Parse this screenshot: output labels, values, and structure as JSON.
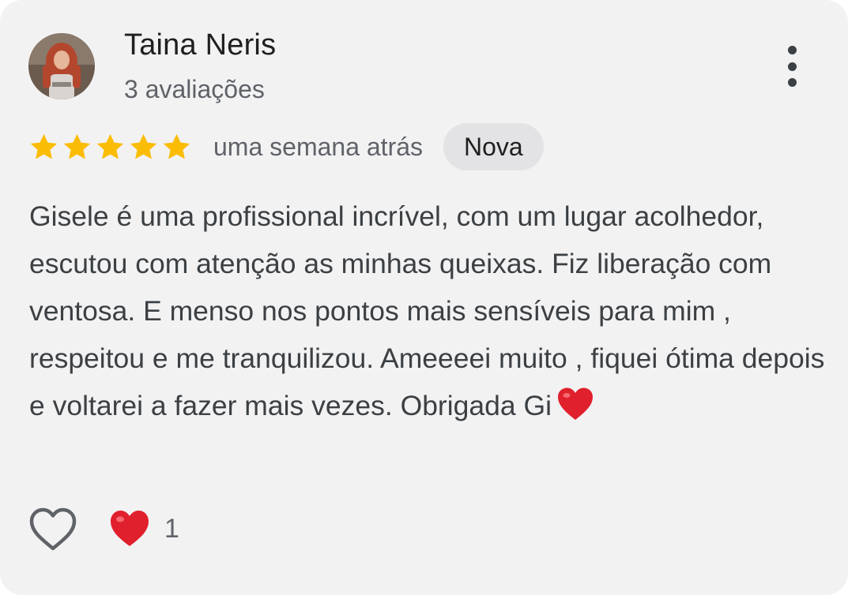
{
  "reviewer": {
    "name": "Taina Neris",
    "reviews_count": "3 avaliações"
  },
  "rating": {
    "stars": 5,
    "max_stars": 5,
    "star_color": "#fbbc04",
    "time_ago": "uma semana atrás",
    "badge": "Nova"
  },
  "review": {
    "text": "Gisele é uma profissional incrível, com um lugar acolhedor, escutou com atenção as minhas queixas. Fiz liberação com ventosa. E menso nos pontos mais sensíveis para mim , respeitou e me tranquilizou. Ameeeei muito , fiquei ótima depois e voltarei a fazer mais vezes. Obrigada Gi",
    "trailing_emoji": "heart-emoji"
  },
  "footer": {
    "like_icon": "heart-outline-icon",
    "reaction_icon": "red-heart-emoji",
    "reaction_count": "1"
  },
  "colors": {
    "card_bg": "#f2f2f3",
    "badge_bg": "#e3e3e5",
    "heart_red": "#e0202c"
  }
}
